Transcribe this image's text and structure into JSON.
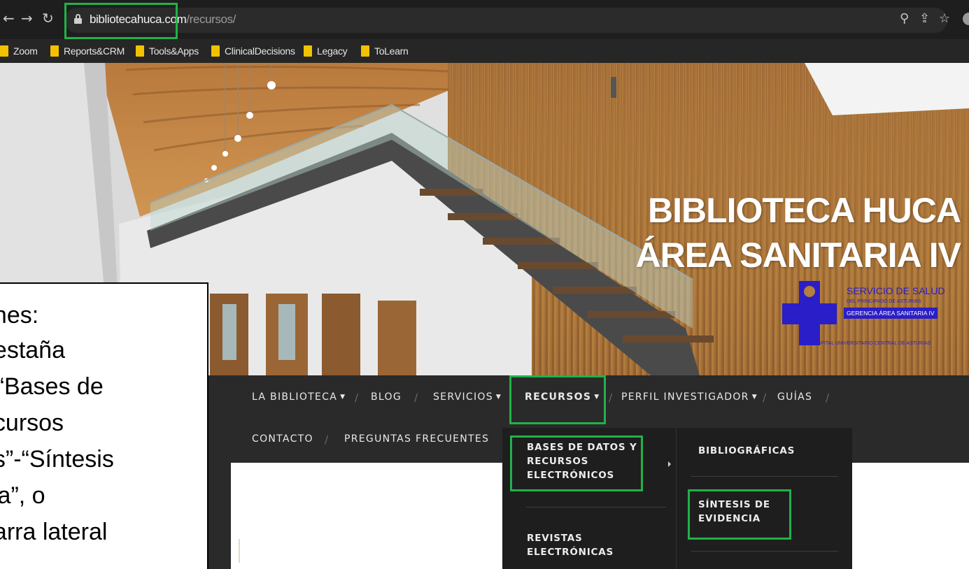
{
  "browser": {
    "url_host": "bibliotecahuca.com",
    "url_path": "/recursos/",
    "icons": [
      "back-arrow-icon",
      "forward-arrow-icon",
      "reload-icon",
      "lock-icon",
      "zoom-icon",
      "share-icon",
      "star-icon"
    ]
  },
  "bookmarks": [
    "Zoom",
    "Reports&CRM",
    "Tools&Apps",
    "ClinicalDecisions",
    "Legacy",
    "ToLearn"
  ],
  "hero": {
    "title_line1": "BIBLIOTECA HUCA",
    "title_line2": "ÁREA SANITARIA IV",
    "logo": {
      "line1": "SERVICIO DE SALUD",
      "line2": "DEL PRINCIPADO DE ASTURIAS",
      "line3": "GERENCIA ÁREA SANITARIA IV",
      "line4": "HOSPITAL UNIVERSITARIO CENTRAL DE ASTURIAS"
    }
  },
  "nav": {
    "row1": [
      "LA BIBLIOTECA",
      "BLOG",
      "SERVICIOS",
      "RECURSOS",
      "PERFIL INVESTIGADOR",
      "GUÍAS"
    ],
    "row2": [
      "CONTACTO",
      "PREGUNTAS FRECUENTES"
    ],
    "separator": "/"
  },
  "dropdown": {
    "col1": [
      "BASES DE DATOS Y\nRECURSOS\nELECTRÓNICOS",
      "REVISTAS\nELECTRÓNICAS"
    ],
    "col2": [
      "BIBLIOGRÁFICAS",
      "SÍNTESIS DE\nEVIDENCIA"
    ]
  },
  "callout": [
    "ones:",
    "pestaña",
    "”-“Bases de",
    "ecursos",
    "os”-“Síntesis",
    "cia”, o",
    "barra lateral"
  ],
  "colors": {
    "highlight": "#21b14a",
    "logo_blue": "#2a1ec8",
    "nav_bg": "#2a2a2a",
    "bookmark_folder": "#f2c200"
  }
}
